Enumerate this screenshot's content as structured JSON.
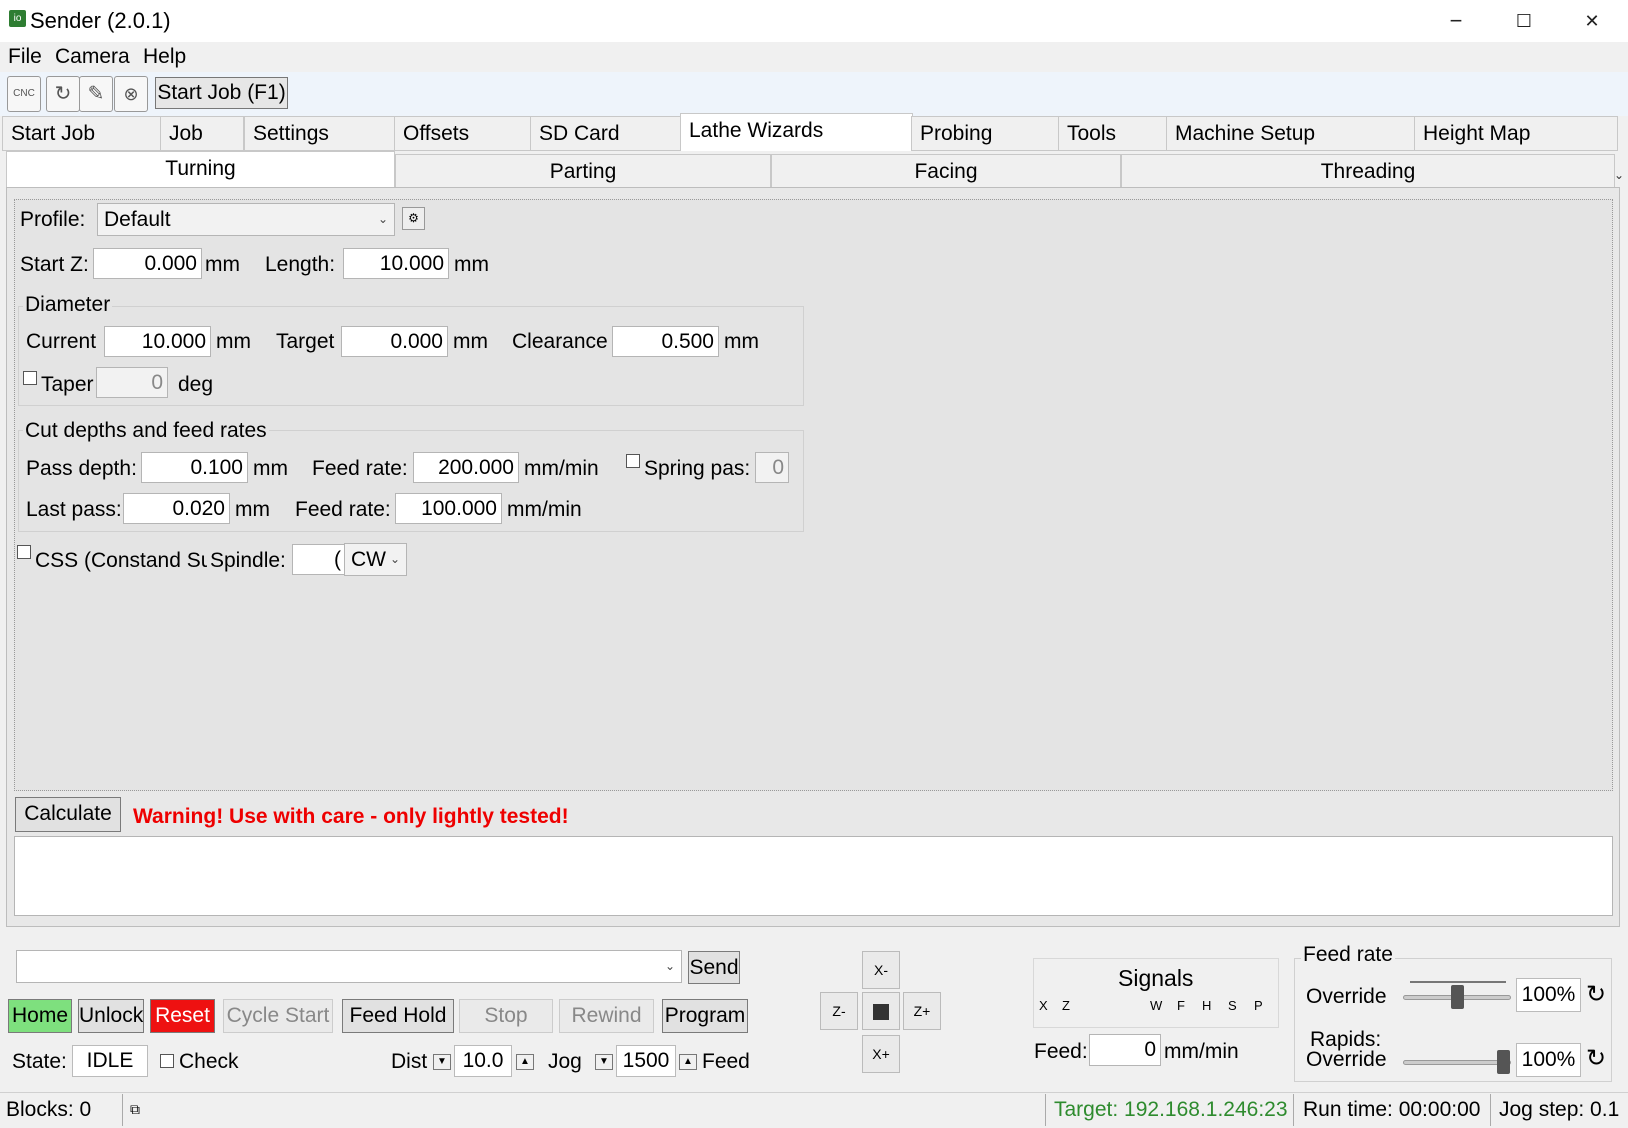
{
  "window": {
    "title": "Sender (2.0.1)",
    "icon_text": "io",
    "minimize": "−",
    "maximize": "☐",
    "close": "✕"
  },
  "menu": [
    "File",
    "Camera",
    "Help"
  ],
  "toolbar": {
    "start_job_label": "Start Job (F1)",
    "icons": [
      "open-cnc-icon",
      "reload-icon",
      "edit-icon",
      "close-file-icon"
    ],
    "cnc_text": "CNC"
  },
  "main_tabs": [
    "Start Job",
    "Job",
    "Settings",
    "Offsets",
    "SD Card",
    "Lathe Wizards",
    "Probing",
    "Tools",
    "Machine Setup",
    "Height Map"
  ],
  "sub_tabs": [
    "Turning",
    "Parting",
    "Facing",
    "Threading"
  ],
  "turning": {
    "profile_label": "Profile:",
    "profile_value": "Default",
    "start_z_label": "Start Z:",
    "start_z_value": "0.000",
    "length_label": "Length:",
    "length_value": "10.000",
    "unit_mm": "mm",
    "unit_mm_min": "mm/min",
    "diameter": {
      "title": "Diameter",
      "current_label": "Current",
      "current_value": "10.000",
      "target_label": "Target",
      "target_value": "0.000",
      "clearance_label": "Clearance",
      "clearance_value": "0.500",
      "taper_label": "Taper",
      "taper_value": "0",
      "deg_label": "deg"
    },
    "cut": {
      "title": "Cut depths and feed rates",
      "pass_depth_label": "Pass depth:",
      "pass_depth_value": "0.100",
      "feed_rate_label": "Feed rate:",
      "feed_rate_value": "200.000",
      "spring_label": "Spring pas:",
      "spring_value": "0",
      "last_pass_label": "Last pass:",
      "last_pass_value": "0.020",
      "last_feed_rate_value": "100.000"
    },
    "css_label": "CSS (Constand Su",
    "spindle_label": "Spindle:",
    "spindle_value": "(",
    "spindle_dir": "CW",
    "calculate_label": "Calculate",
    "warning": "Warning! Use with care - only lightly tested!"
  },
  "controls": {
    "send_label": "Send",
    "home": "Home",
    "unlock": "Unlock",
    "reset": "Reset",
    "cycle_start": "Cycle Start",
    "feed_hold": "Feed Hold",
    "stop": "Stop",
    "rewind": "Rewind",
    "program": "Program",
    "state_label": "State:",
    "state_value": "IDLE",
    "check_label": "Check",
    "dist_label": "Dist",
    "dist_value": "10.0",
    "jog_label": "Jog",
    "jog_value": "1500",
    "feed_label": "Feed",
    "jog_buttons": {
      "x_minus": "X-",
      "z_minus": "Z-",
      "z_plus": "Z+",
      "x_plus": "X+"
    },
    "highlight_colors": {
      "home": "#7ee07e",
      "reset": "#ee1111"
    }
  },
  "signals": {
    "title": "Signals",
    "axes": [
      "X",
      "Z"
    ],
    "flags": [
      "W",
      "F",
      "H",
      "S",
      "P"
    ],
    "feed_label": "Feed:",
    "feed_value": "0",
    "feed_unit": "mm/min"
  },
  "overrides": {
    "feed_rate_title": "Feed rate",
    "override_label": "Override",
    "feed_override_value": "100%",
    "feed_override_level": 0.5,
    "rapids_label": "Rapids:",
    "rapids_override_label": "Override",
    "rapids_override_value": "100%",
    "rapids_override_level": 1.0
  },
  "status": {
    "blocks": "Blocks: 0",
    "target": "Target: 192.168.1.246:23",
    "run_time": "Run time: 00:00:00",
    "jog_step": "Jog step: 0.1"
  }
}
